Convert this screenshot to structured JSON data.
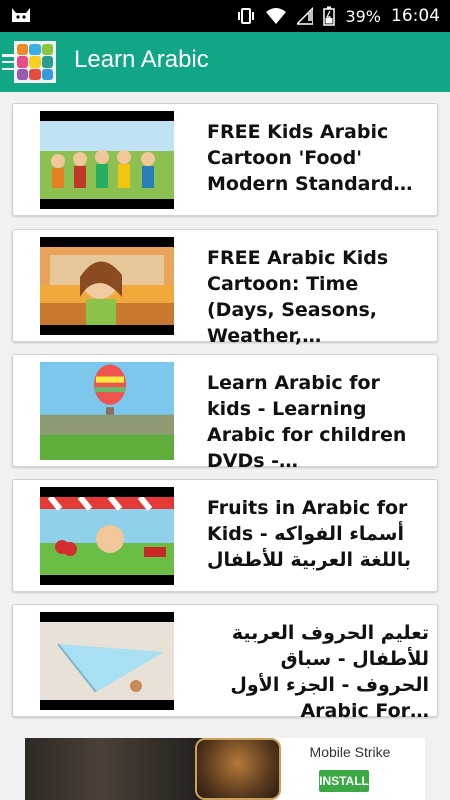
{
  "status_bar": {
    "battery_percent": "39%",
    "time": "16:04"
  },
  "app_bar": {
    "title": "Learn Arabic"
  },
  "videos": [
    {
      "title": "FREE Kids Arabic Cartoon 'Food' Modern Standard…",
      "rtl": false
    },
    {
      "title": "FREE Arabic Kids Cartoon: Time (Days, Seasons, Weather,…",
      "rtl": false
    },
    {
      "title": "Learn Arabic for kids - Learning Arabic for children DVDs -…",
      "rtl": false
    },
    {
      "title": "Fruits in Arabic for Kids - أسماء الفواكه باللغة العربية للأطفال",
      "rtl": false
    },
    {
      "title": "تعليم الحروف العربية للأطفال - سباق الحروف - الجزء الأول Arabic For…",
      "rtl": true
    }
  ],
  "ad": {
    "app_name": "Mobile Strike",
    "install_label": "INSTALL"
  },
  "colors": {
    "accent": "#11a685",
    "install": "#3aa843"
  }
}
